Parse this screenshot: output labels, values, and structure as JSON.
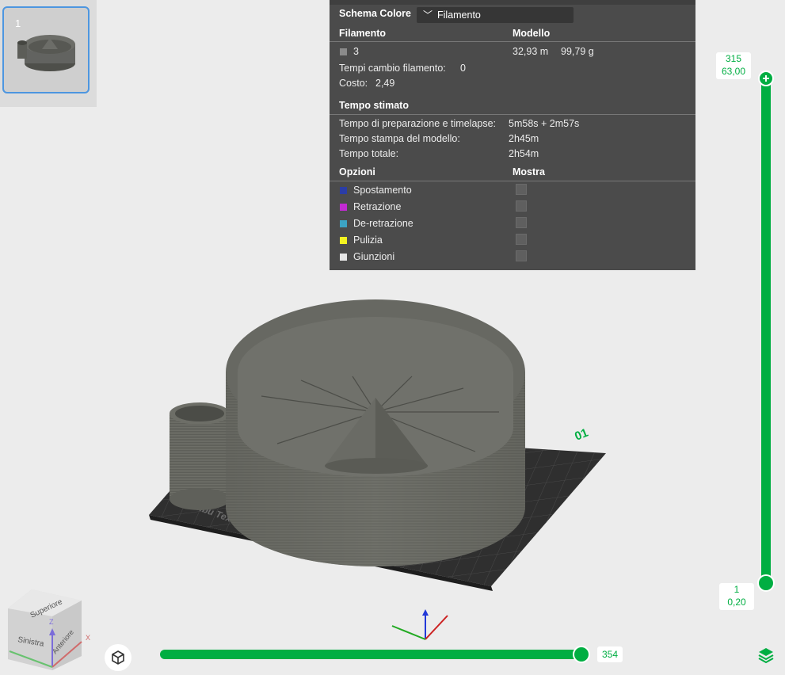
{
  "plate": {
    "number": "1"
  },
  "stats": {
    "color_scheme_label": "Schema Colore",
    "color_scheme_value": "Filamento",
    "filament_header": "Filamento",
    "model_header": "Modello",
    "filament_id": "3",
    "filament_length": "32,93 m",
    "filament_weight": "99,79 g",
    "filament_swatch_color": "#8a8a8a",
    "changes_label": "Tempi cambio filamento:",
    "changes_value": "0",
    "cost_label": "Costo:",
    "cost_value": "2,49",
    "time_header": "Tempo stimato",
    "times": [
      {
        "label": "Tempo di preparazione e timelapse:",
        "value": "5m58s + 2m57s"
      },
      {
        "label": "Tempo stampa del modello:",
        "value": "2h45m"
      },
      {
        "label": "Tempo totale:",
        "value": "2h54m"
      }
    ],
    "options_header": "Opzioni",
    "show_header": "Mostra",
    "options": [
      {
        "label": "Spostamento",
        "color": "#2b3da6",
        "checked": false
      },
      {
        "label": "Retrazione",
        "color": "#c22ad2",
        "checked": false
      },
      {
        "label": "De-retrazione",
        "color": "#3ca3c3",
        "checked": false
      },
      {
        "label": "Pulizia",
        "color": "#f3f320",
        "checked": false
      },
      {
        "label": "Giunzioni",
        "color": "#e6e6e6",
        "checked": false
      }
    ]
  },
  "plate_label": "Bambu Textured PEI Plate",
  "plate_number_label": "01",
  "layer_slider": {
    "top_layer": "315",
    "top_height": "63,00",
    "bottom_layer": "1",
    "bottom_height": "0,20"
  },
  "move_slider": {
    "value": "354"
  },
  "view_cube": {
    "top_face": "Superiore",
    "left_face": "Sinistra",
    "front_face": "Anteriore",
    "axis_x": "X",
    "axis_z": "Z"
  },
  "colors": {
    "accent": "#00ae42",
    "panel": "#4b4b4b",
    "selection": "#4d96e0"
  }
}
